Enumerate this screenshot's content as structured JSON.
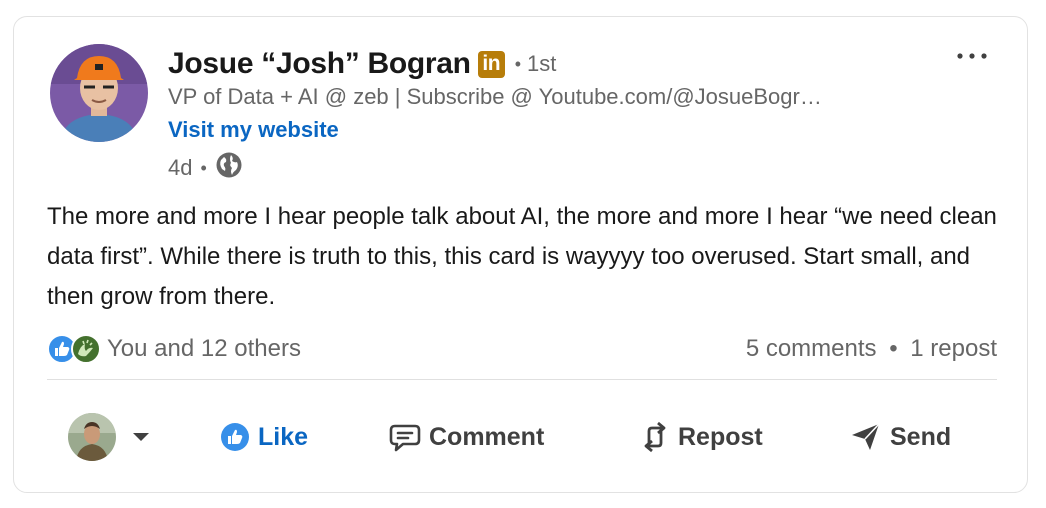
{
  "author": {
    "name": "Josue “Josh” Bogran",
    "badge": "in",
    "degree_separator": "•",
    "degree": "1st",
    "headline": "VP of Data + AI @ zeb | Subscribe @ Youtube.com/@JosueBogr…",
    "website_link": "Visit my website",
    "timestamp": "4d",
    "time_separator": "•",
    "visibility_icon": "globe-icon"
  },
  "menu_icon": "more-horizontal-icon",
  "post": {
    "text": "The more and more I hear people talk about AI, the more and more I hear “we need clean data first”. While there is truth to this, this card is wayyyy too overused. Start small, and then grow from there."
  },
  "social": {
    "reaction_icons": [
      "like-reaction-icon",
      "celebrate-reaction-icon"
    ],
    "reactions_text": "You and 12 others",
    "comments": "5 comments",
    "separator": "•",
    "reposts": "1 repost"
  },
  "actions": {
    "actor_caret_icon": "caret-down-icon",
    "like": "Like",
    "comment": "Comment",
    "repost": "Repost",
    "send": "Send"
  },
  "colors": {
    "link_blue": "#0a66c2",
    "badge_gold": "#b77d0a",
    "muted_text": "#666666",
    "main_text": "#191919"
  }
}
